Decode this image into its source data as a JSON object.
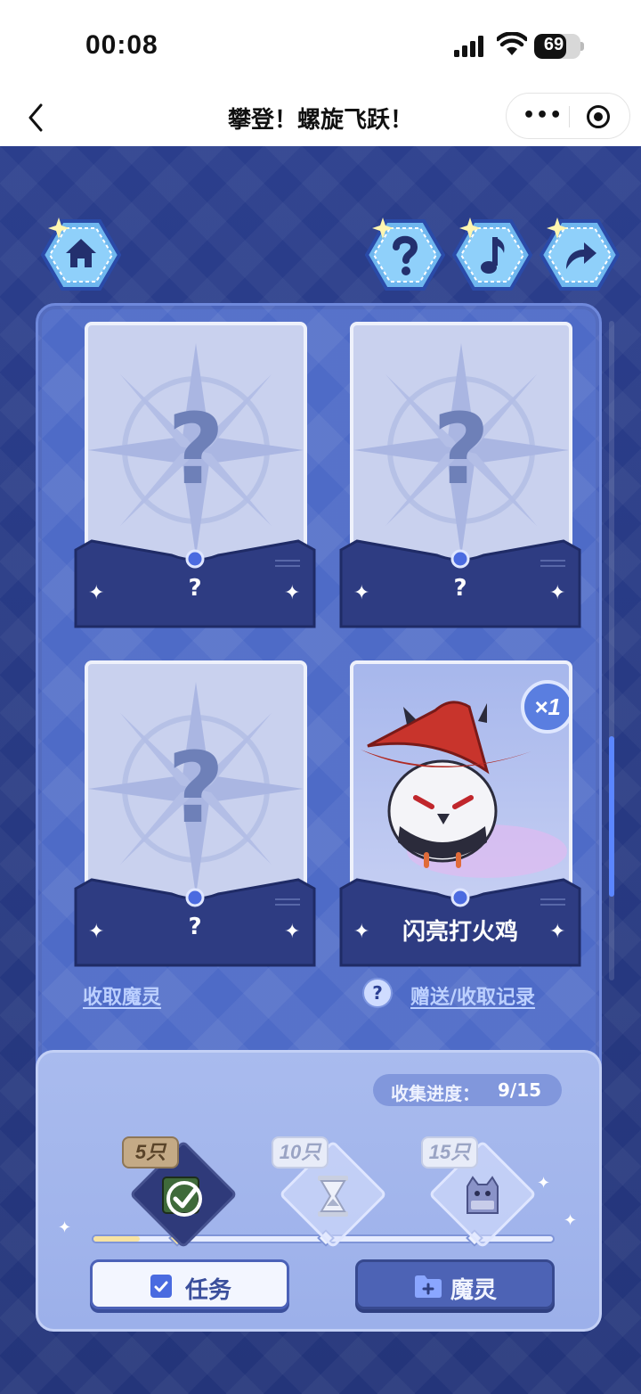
{
  "status_bar": {
    "time": "00:08",
    "battery": "69",
    "battery_level": 0.69
  },
  "nav_bar": {
    "title": "攀登！螺旋飞跃！",
    "more_label": "•••",
    "back_icon": "chevron-left-icon",
    "close_icon": "target-icon"
  },
  "top_buttons": [
    {
      "icon": "home-icon"
    },
    {
      "icon": "help-icon"
    },
    {
      "icon": "music-icon"
    },
    {
      "icon": "share-icon"
    }
  ],
  "cards": [
    {
      "name": "?",
      "placeholder": "?"
    },
    {
      "name": "?",
      "placeholder": "?"
    },
    {
      "name": "?",
      "placeholder": "?"
    },
    {
      "name": "闪亮打火鸡",
      "count": "×1"
    }
  ],
  "links": {
    "collect": "收取魔灵",
    "history_icon": "?",
    "history": "赠送/收取记录"
  },
  "progress": {
    "label": "收集进度：",
    "value": "9/15",
    "fraction": 0.1
  },
  "rewards": [
    {
      "tag": "5只",
      "status": "done"
    },
    {
      "tag": "10只"
    },
    {
      "tag": "15只"
    }
  ],
  "buttons": {
    "task": "任务",
    "spirit": "魔灵"
  },
  "colors": {
    "background": "#2b3e8c",
    "panel": "#4e6bc7",
    "accent": "#5b86ff"
  }
}
